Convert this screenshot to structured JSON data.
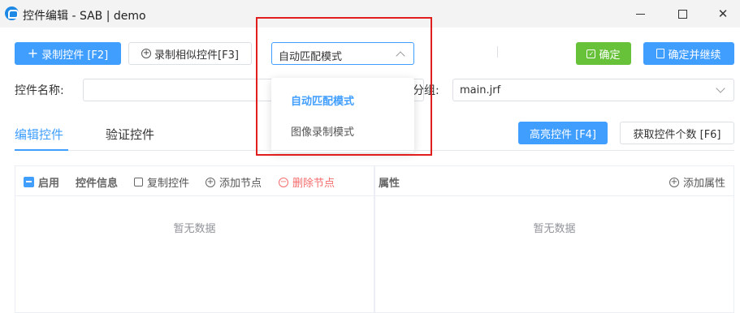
{
  "window": {
    "title": "控件编辑 - SAB | demo",
    "minimize_glyph": "",
    "maximize_glyph": "",
    "close_glyph": "✕"
  },
  "toolbar": {
    "record_label": "录制控件 [F2]",
    "record_similar_label": "录制相似控件[F3]",
    "mode_value": "自动匹配模式",
    "confirm_label": "确定",
    "confirm_continue_label": "确定并继续"
  },
  "form": {
    "name_label": "控件名称:",
    "name_value": "",
    "group_label": "分组:",
    "group_value": "main.jrf"
  },
  "mode_dropdown": {
    "options": [
      "自动匹配模式",
      "图像录制模式"
    ],
    "selected": "自动匹配模式"
  },
  "tabs": {
    "edit": "编辑控件",
    "verify": "验证控件"
  },
  "actions": {
    "highlight_label": "高亮控件 [F4]",
    "count_label": "获取控件个数 [F6]"
  },
  "left_panel": {
    "enable_label": "启用",
    "info_label": "控件信息",
    "copy_label": "复制控件",
    "add_node_label": "添加节点",
    "delete_node_label": "删除节点",
    "empty_text": "暂无数据"
  },
  "right_panel": {
    "title": "属性",
    "add_attr_label": "添加属性",
    "empty_text": "暂无数据"
  },
  "colors": {
    "primary": "#409eff",
    "success": "#67c23a",
    "danger": "#f56c6c",
    "annotation": "#e01e1e"
  }
}
